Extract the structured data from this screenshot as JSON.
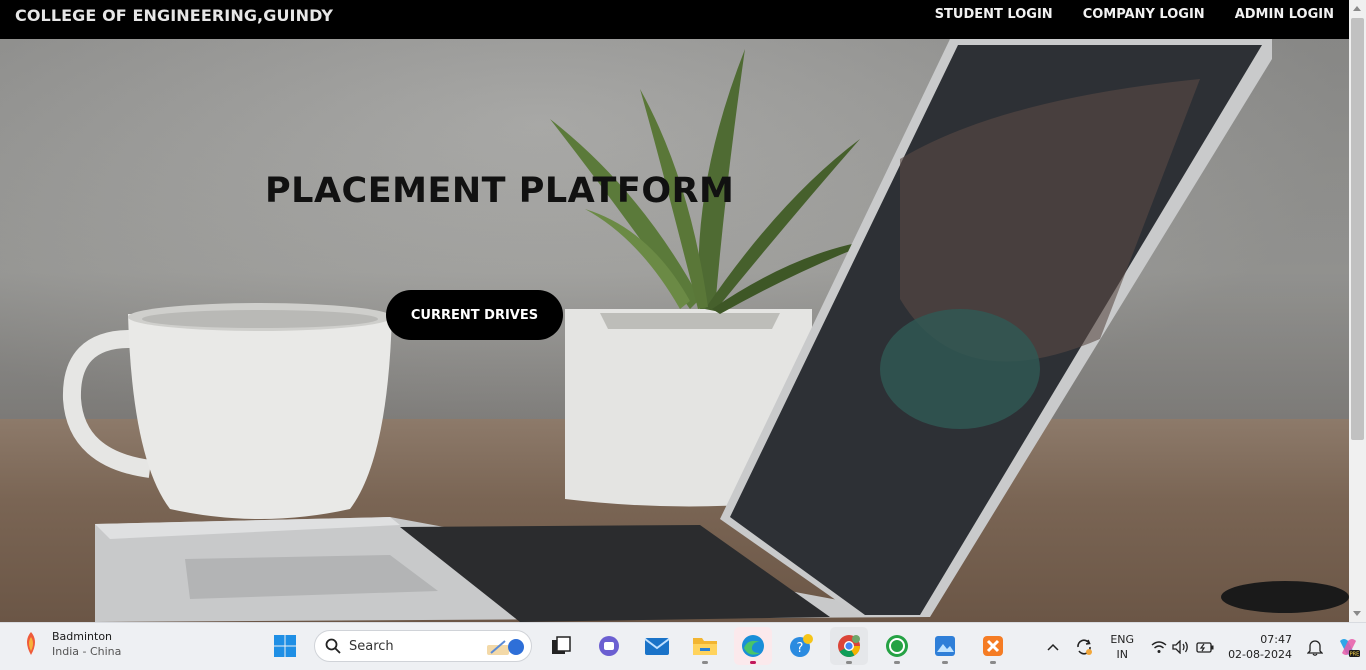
{
  "navbar": {
    "brand": "COLLEGE OF ENGINEERING,GUINDY",
    "links": [
      "STUDENT LOGIN",
      "COMPANY LOGIN",
      "ADMIN LOGIN"
    ]
  },
  "hero": {
    "title": "PLACEMENT PLATFORM",
    "button_label": "CURRENT DRIVES"
  },
  "taskbar": {
    "weather": {
      "title": "Badminton",
      "subtitle": "India - China"
    },
    "search_label": "Search",
    "apps": [
      "windows-start-icon",
      "task-view-icon",
      "teams-chat-icon",
      "mail-icon",
      "file-explorer-icon",
      "edge-icon",
      "tips-icon",
      "chrome-icon",
      "whatsapp-icon",
      "photos-icon",
      "xampp-icon"
    ],
    "language": {
      "line1": "ENG",
      "line2": "IN"
    },
    "clock": {
      "time": "07:47",
      "date": "02-08-2024"
    }
  },
  "colors": {
    "navbar_bg": "#000000",
    "button_bg": "#000000",
    "taskbar_bg": "#eef0f3"
  }
}
